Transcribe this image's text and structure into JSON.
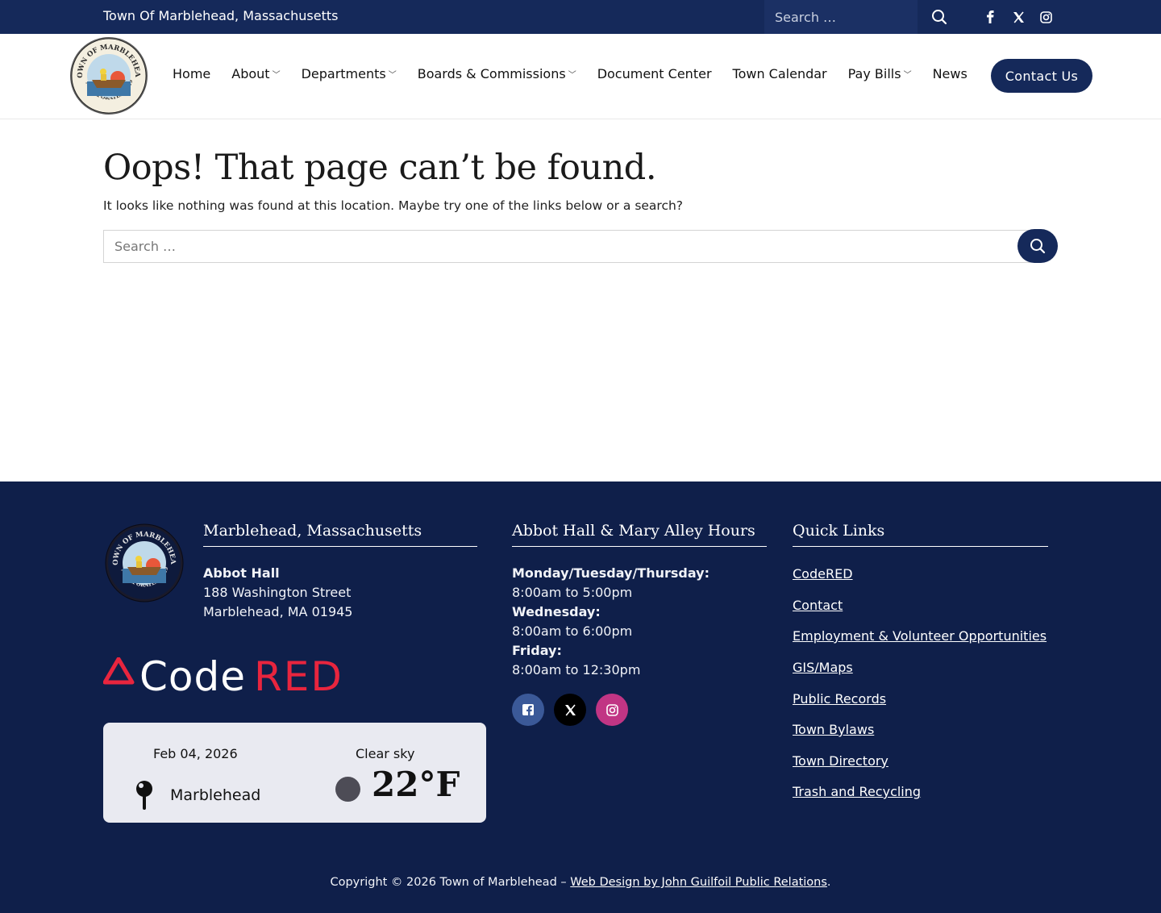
{
  "topbar": {
    "site_name": "Town Of Marblehead, Massachusetts",
    "search_placeholder": "Search …",
    "social": [
      "facebook-icon",
      "x-icon",
      "instagram-icon"
    ]
  },
  "header": {
    "logo_text_top": "TOWN OF MARBLEHEAD",
    "logo_text_bottom": "INCORPORATED 1649",
    "nav": [
      {
        "label": "Home",
        "dropdown": false
      },
      {
        "label": "About",
        "dropdown": true
      },
      {
        "label": "Departments",
        "dropdown": true
      },
      {
        "label": "Boards & Commissions",
        "dropdown": true
      },
      {
        "label": "Document Center",
        "dropdown": false
      },
      {
        "label": "Town Calendar",
        "dropdown": false
      },
      {
        "label": "Pay Bills",
        "dropdown": true
      },
      {
        "label": "News",
        "dropdown": false
      }
    ],
    "contact_label": "Contact Us"
  },
  "main": {
    "title": "Oops! That page can’t be found.",
    "subtitle": "It looks like nothing was found at this location. Maybe try one of the links below or a search?",
    "search_placeholder": "Search …"
  },
  "footer": {
    "col1": {
      "heading": "Marblehead, Massachusetts",
      "place": "Abbot Hall",
      "street": "188 Washington Street",
      "city": "Marblehead, MA 01945"
    },
    "codered": {
      "code": "Code",
      "red": "RED"
    },
    "weather": {
      "date": "Feb 04, 2026",
      "sky": "Clear sky",
      "city": "Marblehead",
      "temp": "22°F"
    },
    "col2": {
      "heading": "Abbot Hall & Mary Alley Hours",
      "hours": [
        {
          "day": "Monday/Tuesday/Thursday:",
          "time": "8:00am to 5:00pm"
        },
        {
          "day": "Wednesday:",
          "time": "8:00am to 6:00pm"
        },
        {
          "day": "Friday:",
          "time": "8:00am to 12:30pm"
        }
      ],
      "social": [
        "facebook-icon",
        "x-icon",
        "instagram-icon"
      ]
    },
    "col3": {
      "heading": "Quick Links",
      "links": [
        "CodeRED",
        "Contact",
        "Employment & Volunteer Opportunities",
        "GIS/Maps",
        "Public Records",
        "Town Bylaws",
        "Town Directory",
        "Trash and Recycling"
      ]
    },
    "copyright_text": "Copyright © 2026 Town of Marblehead – ",
    "copyright_link": "Web Design by John Guilfoil Public Relations",
    "copyright_end": ".",
    "colors": {
      "navy": "#15295a",
      "footer": "#0f1f4a",
      "red": "#e8253e"
    }
  }
}
